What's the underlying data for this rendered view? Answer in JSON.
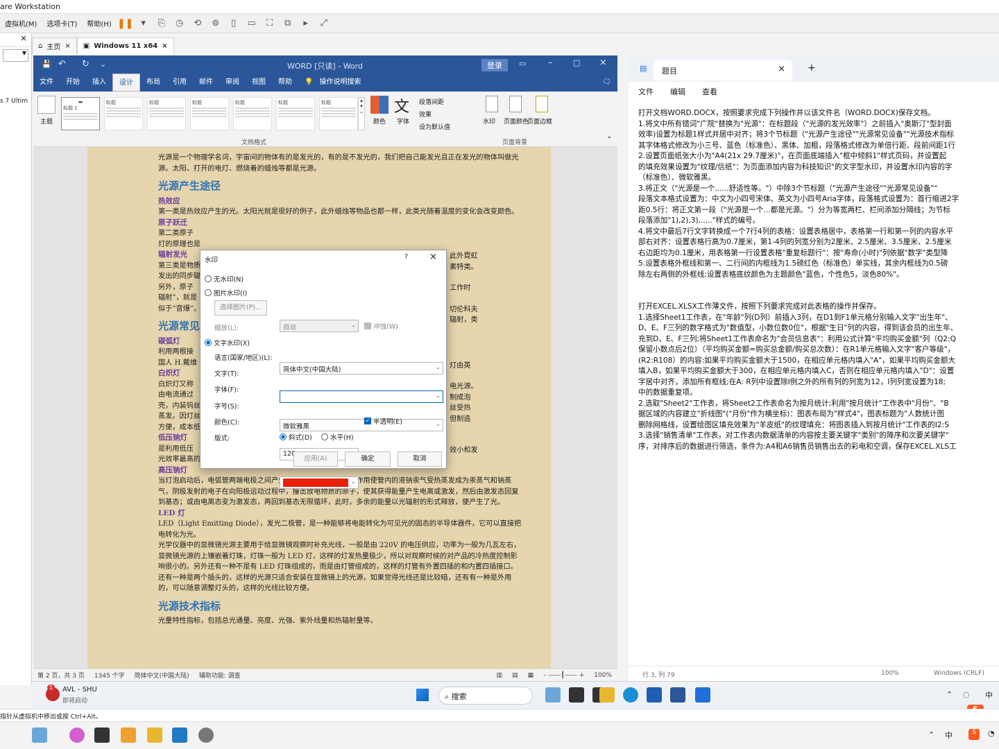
{
  "vm": {
    "title": "are Workstation",
    "menu": [
      "虚拟机(M)",
      "选项卡(T)",
      "帮助(H)"
    ],
    "left_label": "s 7 Ultim",
    "tabs": [
      {
        "label": "主页"
      },
      {
        "label": "Windows 11 x64"
      }
    ],
    "status_text": "指针从虚拟机中移出或按 Ctrl+Alt。"
  },
  "word": {
    "title": "WORD [只读] - Word",
    "login": "登录",
    "tabs": [
      "文件",
      "开始",
      "插入",
      "设计",
      "布局",
      "引用",
      "邮件",
      "审阅",
      "视图",
      "帮助",
      "操作说明搜索"
    ],
    "active_tab": "设计",
    "ribbon": {
      "theme": "主题",
      "colors": "颜色",
      "fonts": "字体",
      "para_spacing": "段落间距",
      "effects": "效果",
      "set_default": "设为默认值",
      "watermark": "水印",
      "page_color": "页面颜色",
      "page_border": "页面边框",
      "group_format": "文档格式",
      "group_bg": "页面背景",
      "style_label": "标题",
      "style_label_1": "标题 1"
    },
    "doc": {
      "intro": "光源是一个物理学名词，宇宙间的物体有的是发光的，有的是不发光的，我们把自己能发光且正在发光的物体叫做光源。太阳、打开的电灯、燃烧着的蜡烛等都是光源。",
      "h1": "光源产生途径",
      "s1": "热效应",
      "p1": "第一类是热效应产生的光。太阳光就是很好的例子，此外蜡烛等物品也都一样，此类光随着温度的变化会改变颜色。",
      "s2": "原子跃迁",
      "p2": "第二类原子",
      "p2b": "灯的原理也是",
      "s3": "辐射发光",
      "p3": "第三类是物质",
      "p3b": "发出的同步辐",
      "p3c": "另外，原子",
      "p3d": "辐射”，就是",
      "p3e": "似于“音爆”。",
      "h2": "光源常见",
      "s4": "碳弧灯",
      "p4": "利用两根接",
      "p4b": "国人 H.戴维",
      "s5": "白炽灯",
      "p5": "白炽灯又称",
      "p5b": "由电流通过",
      "p5c": "壳，内装钨丝",
      "p5d": "蒸发。因灯丝",
      "p5e": "方便，成本低",
      "s6": "低压钠灯",
      "p6": "是利用低压",
      "p6b": "光效率最高的电光源。低压钠灯发出的是单色黄光，用于对光色没有要求的场所。",
      "s7": "高压钠灯",
      "p7": "当灯泡启动后，电弧管两端电极之间产生电弧，由于电弧的高温作用使管内的液钠汞气受热蒸发成为汞蒸气和钠蒸气，阴极发射的电子在向阳极运动过程中，撞击放电物质的原子，使其获得能量产生电离或激发，然后由激发态回复到基态；或由电离态变为激发态，再回到基态无限循环，此时，多余的能量以光辐射的形式释放，便产生了光。",
      "s8": "LED 灯",
      "p8": "LED（Light Emitting Diode），发光二极管，是一种能够将电能转化为可见光的固态的半导体器件，它可以直接把电转化为光。",
      "p9": "光学仪器中的显微镜光源主要用于给显微镜观察时补充光线，一般是由 220V 的电压供应，功率为一般为几瓦左右，显微镜光源的上镶嵌着灯珠，灯珠一般为 LED 灯，这样的灯发热量极少，所以对观察时候的对产品的冷热度控制影响很小的。另外还有一种不是有 LED 灯珠组成的，而是由灯管组成的，这样的灯管有外置四插的和内置四插接口。还有一种是两个插头的，这样的光源只适合安装在显微镜上的光源，如果觉得光线还是比较暗，还有有一种是外用的，可以随意调整灯头的，这样的光线比较方便。",
      "h3": "光源技术指标",
      "p10": "光量特性指标，包括总光通量、亮度、光强、紫外线量和热辐射量等。",
      "right_frag": [
        "此外霓虹",
        "素特类。",
        "工作时",
        "切伦科夫",
        "辐射，类",
        "灯由英",
        "电光源。",
        "制成泡",
        "丝受热",
        "但制造",
        "效小和发"
      ]
    },
    "status": {
      "page": "第 2 页，共 3 页",
      "words": "1345 个字",
      "lang": "简体中文(中国大陆)",
      "access": "辅助功能: 调查",
      "zoom": "100%"
    }
  },
  "dialog": {
    "title": "水印",
    "help": "?",
    "no_watermark": "无水印(N)",
    "picture_watermark": "图片水印(I)",
    "select_picture": "选择图片(P)...",
    "scale_label": "缩放(L):",
    "scale_value": "自动",
    "washout": "冲蚀(W)",
    "text_watermark": "文字水印(X)",
    "language_label": "语言(国家/地区)(L):",
    "language_value": "简体中文(中国大陆)",
    "text_label": "文字(T):",
    "text_value": "",
    "font_label": "字体(F):",
    "font_value": "微软雅黑",
    "size_label": "字号(S):",
    "size_value": "120",
    "color_label": "颜色(C):",
    "color_value": "#e8200a",
    "semitransparent": "半透明(E)",
    "layout_label": "版式:",
    "diagonal": "斜式(D)",
    "horizontal": "水平(H)",
    "apply": "应用(A)",
    "ok": "确定",
    "cancel": "取消"
  },
  "vm_taskbar": {
    "notif_count": "1",
    "app_name": "AVL - SHU",
    "app_sub": "即将启动",
    "search": "搜索",
    "ime": "中"
  },
  "notepad": {
    "tab_title": "题目",
    "menu": [
      "文件",
      "编辑",
      "查看"
    ],
    "lines": [
      "打开文档WORD.DOCX，按照要求完成下列操作并以该文件名（WORD.DOCX)保存文档。",
      "1.将文中所有错词\"广院\"替换为\"光源\"：在标题段（\"光源的发光效率\"）之前插入\"奥斯汀\"型封面",
      "效率)设置为标题1样式并居中对齐；将3个节标题（\"光源产生途径\"\"光源常见设备\"\"光源技术指标",
      "其字体格式修改为小三号、蓝色（标准色）、黑体、加粗，段落格式修改为单倍行距、段前间距1行",
      "2.设置页面纸张大小为\"A4(21x 29.7厘米)\"，在页面底端插入\"框中倾斜1\"样式页码，并设置起",
      "的填充效果设置为\"纹理/信纸\"：为页面添加内容为科技知识\"的文字型水印，并设置水印内容的字",
      "（标准色）、微软雅黑。",
      "3.将正文（\"光源是一个......舒适性等。\"）中除3个节标题（\"光源产生途径\"\"光源常见设备\"\"",
      "段落文本格式设置为：中文为小四号宋体、英文为小四号Aria字体，段落格式设置为：首行缩进2字",
      "距0.5行：将正文第一段（\"光源是一个...都是光源。\"）分为等宽两栏、栏间添加分隔线；为节标",
      "段落添加\"1),2),3),.....\"样式的编号。",
      "4.将文中最后7行文字转换成一个7行4列的表格：设置表格居中，表格第一行和第一列的内容水平",
      "部右对齐：设置表格行高为0.7厘米，第1-4列的列宽分别为2厘米、2.5厘米、3.5厘米、2.5厘米",
      "右边距均为0.1厘米，用表格第一行设置表格\"重复标题行\"：按\"寿命(小时)\"列依据\"数字\"类型降",
      "5.设置表格外框线和第一、二行间的内框线为1.5磅红色（标准色）单实线，其余内框线为0.5磅",
      "除左右两侧的外框线;设置表格底纹颜色为主题颜色\"蓝色，个性色5，淡色80%\"。",
      "",
      "",
      "打开EXCEL.XLSX工作薄文件，按照下列要求完成对此表格的操作并保存。",
      "1.选择Sheet1工作表，在\"年龄\"列(D列）前插入3列，在D1到F1单元格分别输入文字\"出生年\"、",
      "D、E、F三列的数字格式为\"数值型，小数位数0位\"，根据\"生日\"列的内容，得到该会员的出生年、",
      "充到D、E、F三列;将Sheet1工作表命名为\"会员信息表\"：利用公式计算\"平均购买金额\"列（Q2:Q",
      "保留小数点后2位）（平均购买金额=购买总金额/购买总次数）：在R1单元格输入文字\"客户等级\"，",
      "(R2:R108）的内容:如果平均购买金额大于1500，在相应单元格内填入\"A\"，如果平均购买金额大",
      "填入B，如果平均购买金额大于300，在相应单元格内填入C，否则在相应单元格内填入\"D\"：设置",
      "字居中对齐，添加所有框线;在A: R列中设置除I例之外的所有列的列宽为12，I列列宽设置为18;",
      "中的数据重复项。",
      "2.选取\"Sheet2\"工作表，将Sheet2工作表命名为按月统计;利用\"按月统计\"工作表中\"月份\"、\"B",
      "据区域的内容建立\"折线图\"(\"月份\"作为横坐标)：图表布局为\"样式4\"，图表标题为\"人数统计图",
      "删除网格线，设置绘图区填充效果为\"羊皮纸\"的纹理填充：将图表插入到按月统计\"工作表的I2:S",
      "3.选择\"销售清单\"工作表，对工作表内数据清单的内容按主要关键字\"类别\"的降序和次要关键字\"",
      "序，对排序后的数据进行筛选，条件为:A4和A6销售员销售出去的彩电和空调，保存EXCEL.XLS工"
    ],
    "status": {
      "pos": "行 3, 列 79",
      "zoom": "100%",
      "encoding": "Windows (CRLF)"
    }
  },
  "host_taskbar": {
    "ime1": "中",
    "ime2": "中"
  }
}
